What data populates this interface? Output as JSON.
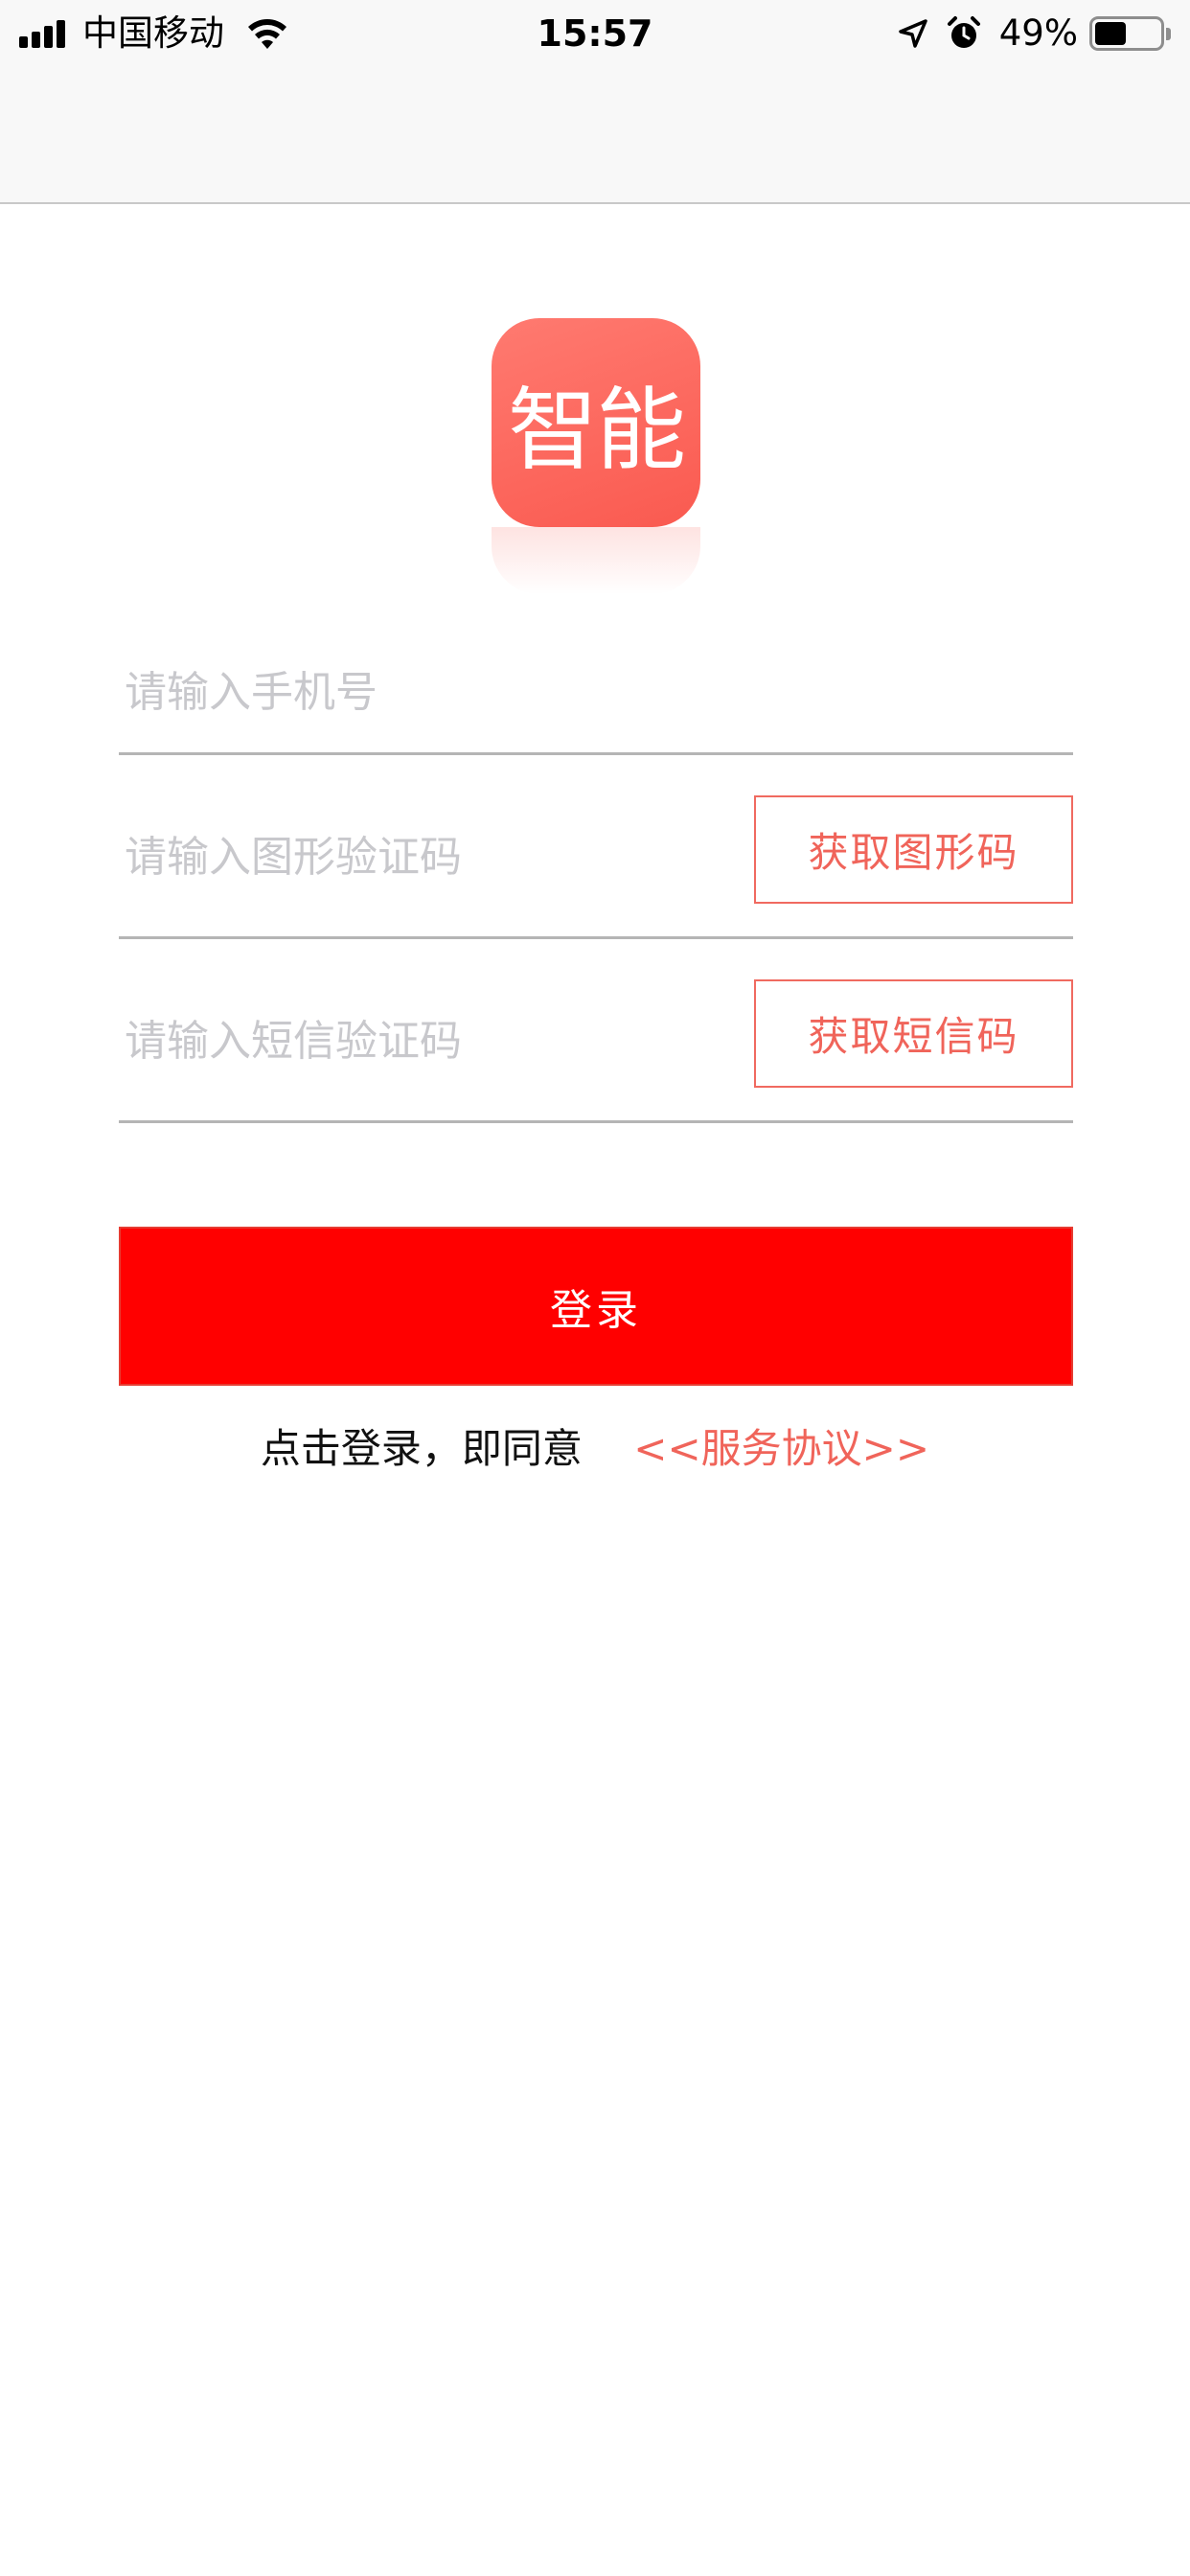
{
  "status_bar": {
    "carrier": "中国移动",
    "time": "15:57",
    "battery_percent": "49%",
    "battery_level": 0.49,
    "icons": [
      "signal-icon",
      "wifi-icon",
      "location-arrow-icon",
      "alarm-icon",
      "battery-icon"
    ]
  },
  "logo": {
    "text": "智能",
    "colors": {
      "from": "#ff7a70",
      "to": "#fa5a50"
    }
  },
  "form": {
    "phone_placeholder": "请输入手机号",
    "image_code_placeholder": "请输入图形验证码",
    "image_code_button": "获取图形码",
    "sms_code_placeholder": "请输入短信验证码",
    "sms_code_button": "获取短信码",
    "login_button": "登录"
  },
  "agreement": {
    "text": "点击登录，即同意",
    "link": "<<服务协议>>"
  },
  "colors": {
    "primary": "#ff0000",
    "accent": "#f0645a",
    "divider": "#b5b5b5",
    "placeholder": "#c8c8cc"
  }
}
